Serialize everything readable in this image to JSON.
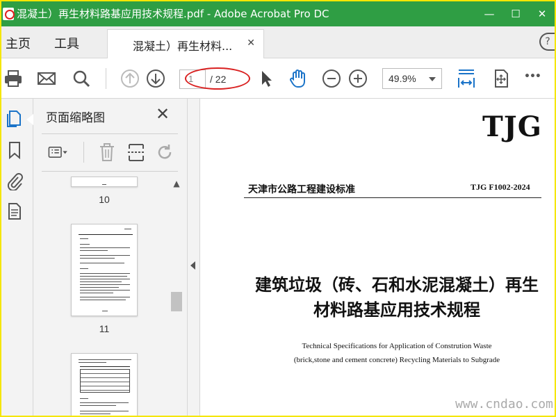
{
  "window": {
    "title": "混凝土）再生材料路基应用技术规程.pdf - Adobe Acrobat Pro DC",
    "minimize_glyph": "—",
    "maximize_glyph": "☐",
    "close_glyph": "✕"
  },
  "tabs": {
    "home_label": "主页",
    "tools_label": "工具",
    "doc_tab_label": "混凝土）再生材料...",
    "doc_tab_close": "✕",
    "help_glyph": "?"
  },
  "toolbar": {
    "page_input_value": "1",
    "page_total": "/ 22",
    "zoom_value": "49.9%",
    "more_glyph": "•••"
  },
  "thumbnails": {
    "panel_title": "页面缩略图",
    "close_glyph": "✕",
    "scroll_up_glyph": "▲",
    "pages": [
      {
        "number": "10"
      },
      {
        "number": "11"
      }
    ]
  },
  "document": {
    "logo": "TJG",
    "standard_org": "天津市公路工程建设标准",
    "standard_code": "TJG F1002-2024",
    "title_line1": "建筑垃圾（砖、石和水泥混凝土）再生",
    "title_line2": "材料路基应用技术规程",
    "english_line1": "Technical Specifications for Application of Constrution Waste",
    "english_line2": "(brick,stone and cement concrete) Recycling Materials to Subgrade"
  },
  "watermark": "www.cndao.com",
  "colors": {
    "titlebar": "#2f9e44",
    "frame": "#f5e600",
    "accent_blue": "#1a73c8",
    "annotation_red": "#d92020"
  }
}
